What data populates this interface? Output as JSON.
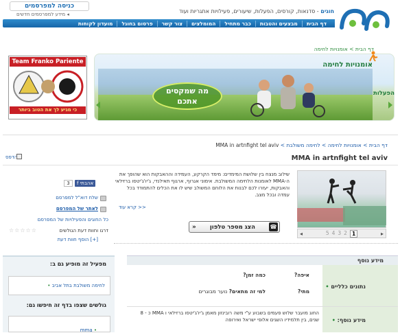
{
  "header": {
    "advertisers_login": "כניסה למפרסמים",
    "advertisers_news": "מידע למפרסמים חדשים",
    "brand": "חוגים",
    "tagline_rest": " - סדנאות, קורסים, הפעלות, שיעורים, פעילויות אתגריות ועוד",
    "nav": [
      "דף הבית",
      "מבצעים והטבות",
      "כבר מתחיל",
      "המומלצים",
      "צור קשר",
      "פרסום בחוגל",
      "מועדון לקוחות"
    ]
  },
  "breadcrumb_top": {
    "home": "דף הבית",
    "sep": " > ",
    "current": "אומנויות לחימה"
  },
  "banner": {
    "title": "אומנויות לחימה",
    "events_label": "הפעלות",
    "bubble_line1": "מה שמקסים",
    "bubble_line2": "אתכם"
  },
  "ad": {
    "header": "Team Franko Pariente",
    "footer": "כי מגיע לך את הטוב ביותר"
  },
  "breadcrumb": {
    "items": [
      "דף הבית",
      "אומנויות לחימה",
      "לחימה משולבת"
    ],
    "current": "MMA in artnfight tel aviv"
  },
  "page": {
    "title": "MMA in artnfight tel aviv",
    "print": "הדפס",
    "description": "שילוב מנצח בין שלושת המימדים: מימד הקרקע, העמידה וההאבקות הוא שהופך את ה-MMA לאומנות הלחימה המשולבת. אימוני אגרוף, ארגוף תאילנדי, ג'יו'ג'יטסו ברזילאי והאבקות, יעזרו לכם לבנות את הלוחם המשולב שיש לו את הכלים להתמודד בכל עמדה ובכל מצב.",
    "read_more": "קרא עוד >>",
    "phone_button": "הצג מספר טלפון",
    "pager": {
      "pages": [
        "1",
        "2",
        "3",
        "4",
        "5"
      ],
      "current": "1"
    }
  },
  "sidebar": {
    "like_label": "אהבתי",
    "like_count": "3",
    "send_email": "שלח דוא\"ל למפרסם",
    "advertiser_site": "לאתר של המפרסם",
    "all_activities": "כל החוגים והפעילויות של המפרסם",
    "rate": "דרגו וחוות דעת הגולשים",
    "add_review": "[+] הוסף חוות דעת"
  },
  "panel": {
    "title1": "מפעיל זה מופיע גם ב:",
    "link1": "לחימה משולבת בתל אביב",
    "title2": "גולשים שצפו בדף זה חיפשו גם:",
    "link2": "mma"
  },
  "info": {
    "header": "מידע נוסף",
    "general": "נתונים כלליים",
    "more": "מידע נוסף:",
    "where_q": "איפה?",
    "cost_q": "כמה זמן?",
    "when_q": "מתי?",
    "who_q": "למי זה מתאים?",
    "who_a": "נוער מבוגרים",
    "long": "החוג מועבר שלוש פעמים בשבוע ע\"י משה רובינזון מאמן ג'יו'ג'יטסו ברזילאי ו MMA כ - 8 שנים, בין תלמידיו השגים אלופי ישראל ואירופה"
  },
  "colors": {
    "nav": "#1665a8",
    "green": "#2a8a3a",
    "ad_red": "#c81f25"
  }
}
